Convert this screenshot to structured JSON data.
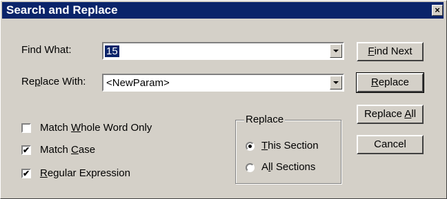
{
  "window": {
    "title": "Search and Replace",
    "close_glyph": "×"
  },
  "find": {
    "label_pre": "Find What:",
    "value": "15"
  },
  "replace": {
    "label_pre": "Re",
    "label_u": "p",
    "label_post": "lace With:",
    "value": "<NewParam>"
  },
  "buttons": {
    "find_next": {
      "u": "F",
      "rest": "ind Next"
    },
    "replace": {
      "u": "R",
      "rest": "eplace"
    },
    "replace_all": {
      "pre": "Replace ",
      "u": "A",
      "post": "ll"
    },
    "cancel": "Cancel"
  },
  "options": {
    "whole_word": {
      "pre": "Match ",
      "u": "W",
      "post": "hole Word Only",
      "checked": false
    },
    "match_case": {
      "pre": "Match ",
      "u": "C",
      "post": "ase",
      "checked": true,
      "mark": "✔"
    },
    "regex": {
      "u": "R",
      "post": "egular Expression",
      "checked": true,
      "mark": "✔"
    }
  },
  "scope": {
    "legend": "Replace",
    "this_section": {
      "u": "T",
      "post": "his Section",
      "selected": true
    },
    "all_sections": {
      "pre": "A",
      "u": "l",
      "post": "l Sections",
      "selected": false
    }
  }
}
